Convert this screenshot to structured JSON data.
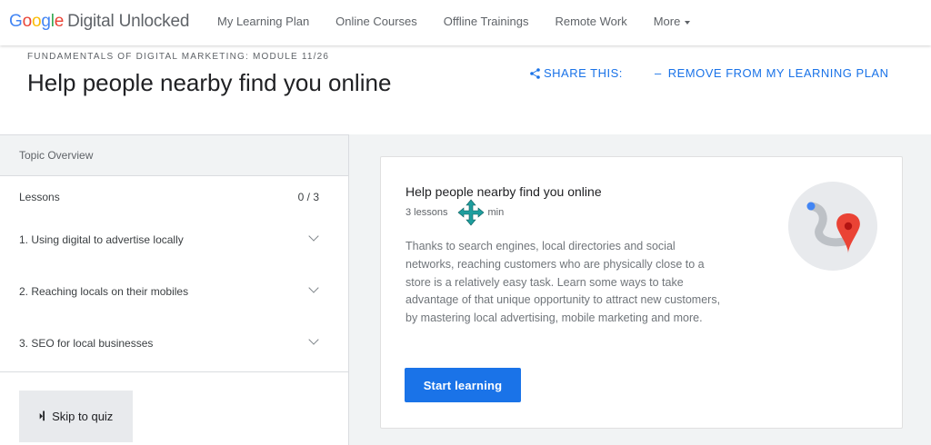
{
  "nav": {
    "logo": {
      "letters": [
        "G",
        "o",
        "o",
        "g",
        "l",
        "e"
      ],
      "colors": [
        "#4285F4",
        "#EA4335",
        "#FBBC05",
        "#4285F4",
        "#34A853",
        "#EA4335"
      ],
      "product": "Digital Unlocked"
    },
    "links": [
      "My Learning Plan",
      "Online Courses",
      "Offline Trainings",
      "Remote Work"
    ],
    "more": "More"
  },
  "header": {
    "module_label": "FUNDAMENTALS OF DIGITAL MARKETING: MODULE 11/26",
    "title": "Help people nearby find you online",
    "share": "SHARE THIS:",
    "remove": "REMOVE FROM MY LEARNING PLAN"
  },
  "sidebar": {
    "topic_overview": "Topic Overview",
    "lessons_label": "Lessons",
    "lessons_count": "0 / 3",
    "lessons": [
      "1. Using digital to advertise locally",
      "2. Reaching locals on their mobiles",
      "3. SEO for local businesses"
    ],
    "quiz_icon": "⏵▎",
    "quiz_label": "Skip to quiz"
  },
  "card": {
    "title": "Help people nearby find you online",
    "lessons": "3 lessons",
    "duration": "min",
    "description": "Thanks to search engines, local directories and social networks, reaching customers who are physically close to a store is a relatively easy task. Learn some ways to take advantage of that unique opportunity to attract new customers, by mastering local advertising, mobile marketing and more.",
    "button": "Start learning"
  },
  "colors": {
    "accent": "#1a73e8",
    "pin": "#ea4335",
    "move_cursor": "#1e9e9e"
  }
}
